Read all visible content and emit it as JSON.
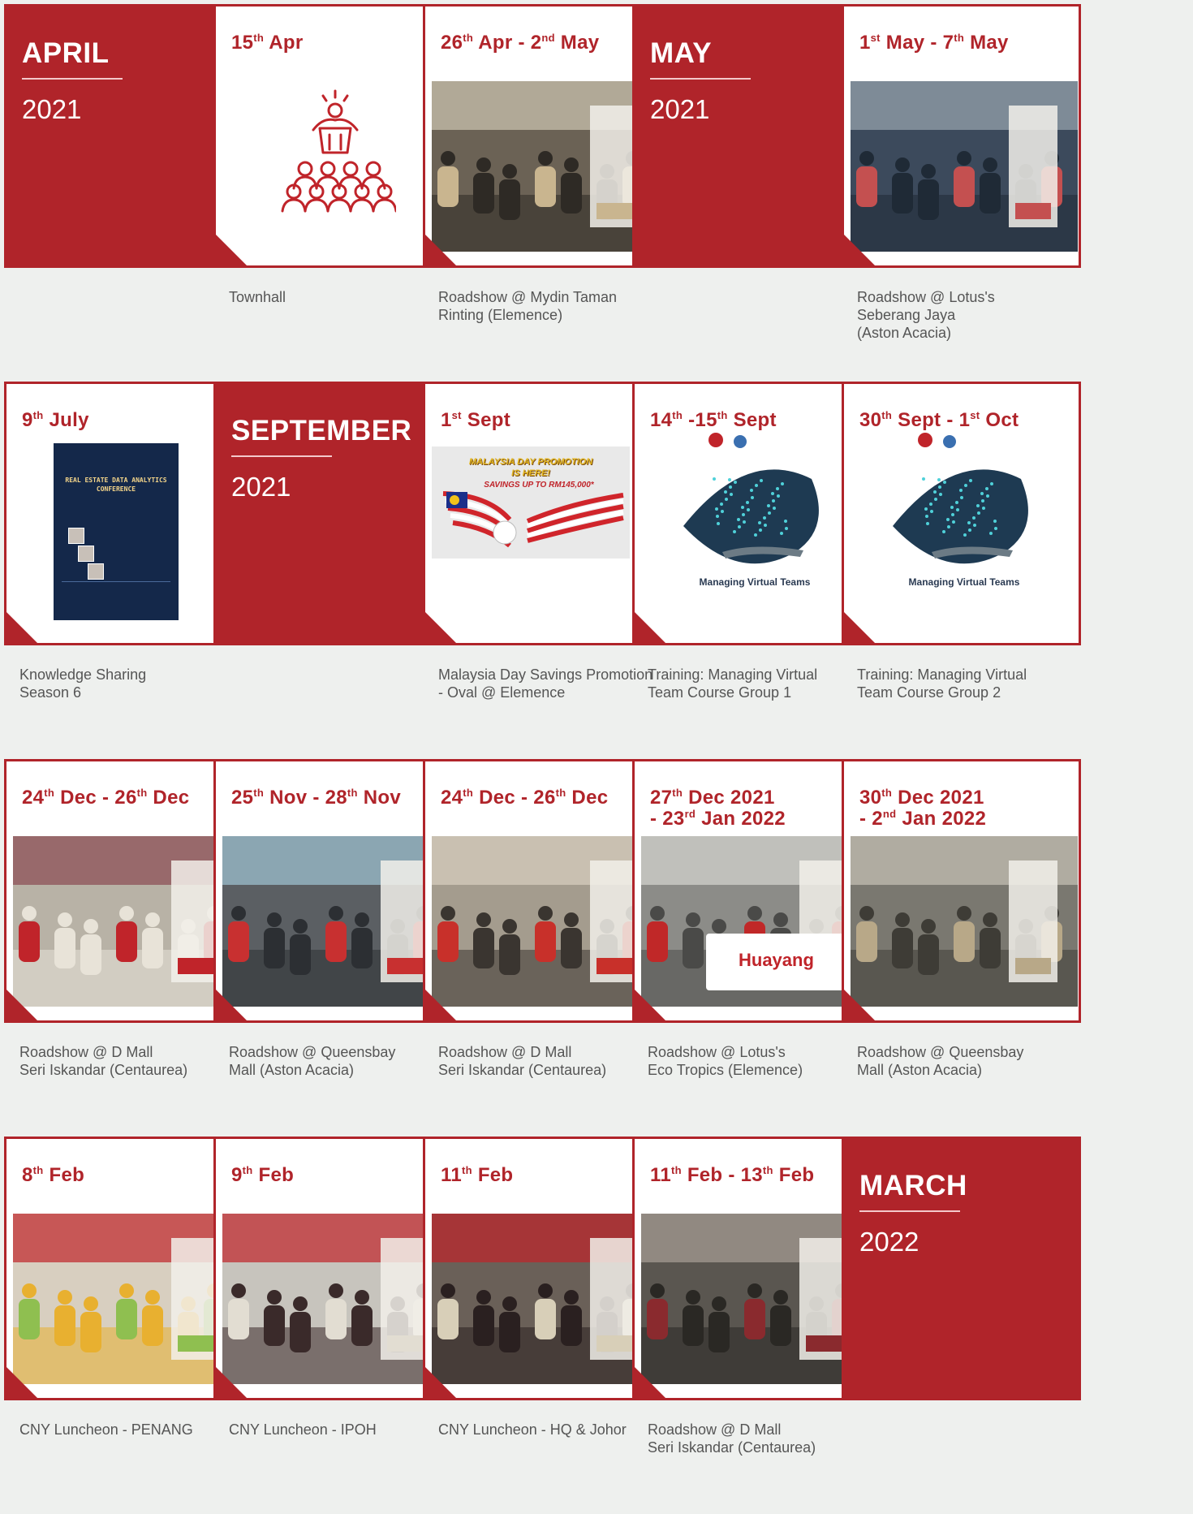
{
  "rows": [
    [
      {
        "month": "APRIL",
        "year": "2021"
      },
      {
        "date": "15",
        "date_sup": "th",
        "date_rest": " Apr",
        "caption": [
          "Townhall"
        ],
        "icon": "townhall-people-icon"
      },
      {
        "date": "26",
        "date_sup": "th",
        "date_rest": " Apr - 2",
        "date_sup2": "nd",
        "date_rest2": " May",
        "caption": [
          "Roadshow @ Mydin Taman",
          "Rinting (Elemence)"
        ]
      },
      {
        "month": "MAY",
        "year": "2021"
      },
      {
        "date": "1",
        "date_sup": "st",
        "date_rest": " May - 7",
        "date_sup2": "th",
        "date_rest2": " May",
        "caption": [
          "Roadshow @ Lotus's",
          "Seberang Jaya",
          "(Aston Acacia)"
        ]
      }
    ],
    [
      {
        "date": "9",
        "date_sup": "th",
        "date_rest": " July",
        "caption": [
          "Knowledge Sharing",
          "Season 6"
        ],
        "poster_title": "REAL ESTATE DATA ANALYTICS CONFERENCE"
      },
      {
        "month": "SEPTEMBER",
        "year": "2021"
      },
      {
        "date": "1",
        "date_sup": "st",
        "date_rest": " Sept",
        "caption": [
          "Malaysia Day Savings Promotion",
          "- Oval @ Elemence"
        ],
        "promo_title": "MALAYSIA DAY PROMOTION IS HERE!",
        "promo_sub": "SAVINGS UP TO RM145,000*"
      },
      {
        "date": "14",
        "date_sup": "th",
        "date_rest": " -15",
        "date_sup2": "th",
        "date_rest2": " Sept",
        "caption": [
          "Training: Managing Virtual",
          "Team Course Group 1"
        ],
        "training_title": "Managing Virtual Teams"
      },
      {
        "date": "30",
        "date_sup": "th",
        "date_rest": " Sept - 1",
        "date_sup2": "st",
        "date_rest2": " Oct",
        "caption": [
          "Training: Managing Virtual",
          "Team Course Group 2"
        ],
        "training_title": "Managing Virtual Teams"
      }
    ],
    [
      {
        "date": "24",
        "date_sup": "th",
        "date_rest": " Dec - 26",
        "date_sup2": "th",
        "date_rest2": " Dec",
        "caption": [
          "Roadshow @ D Mall",
          "Seri Iskandar (Centaurea)"
        ]
      },
      {
        "date": "25",
        "date_sup": "th",
        "date_rest": " Nov - 28",
        "date_sup2": "th",
        "date_rest2": " Nov",
        "caption": [
          "Roadshow @ Queensbay",
          "Mall (Aston Acacia)"
        ]
      },
      {
        "date": "24",
        "date_sup": "th",
        "date_rest": " Dec - 26",
        "date_sup2": "th",
        "date_rest2": " Dec",
        "caption": [
          "Roadshow @ D Mall",
          "Seri Iskandar (Centaurea)"
        ]
      },
      {
        "date": "27",
        "date_sup": "th",
        "date_rest": " Dec 2021",
        "line2": "- 23",
        "line2_sup": "rd",
        "line2_rest": " Jan 2022",
        "caption": [
          "Roadshow @ Lotus's",
          "Eco Tropics (Elemence)"
        ],
        "brand": "Huayang"
      },
      {
        "date": "30",
        "date_sup": "th",
        "date_rest": " Dec 2021",
        "line2": "- 2",
        "line2_sup": "nd",
        "line2_rest": " Jan 2022",
        "caption": [
          "Roadshow @ Queensbay",
          "Mall (Aston Acacia)"
        ]
      }
    ],
    [
      {
        "date": "8",
        "date_sup": "th",
        "date_rest": " Feb",
        "caption": [
          "CNY Luncheon - PENANG"
        ]
      },
      {
        "date": "9",
        "date_sup": "th",
        "date_rest": " Feb",
        "caption": [
          "CNY Luncheon - IPOH"
        ]
      },
      {
        "date": "11",
        "date_sup": "th",
        "date_rest": " Feb",
        "caption": [
          "CNY Luncheon - HQ & Johor"
        ]
      },
      {
        "date": "11",
        "date_sup": "th",
        "date_rest": " Feb - 13",
        "date_sup2": "th",
        "date_rest2": " Feb",
        "caption": [
          "Roadshow @ D Mall",
          "Seri Iskandar (Centaurea)"
        ]
      },
      {
        "month": "MARCH",
        "year": "2022"
      }
    ]
  ],
  "colors": {
    "brand_red": "#b0242a",
    "caption_gray": "#555555",
    "background": "#eef0ee"
  }
}
